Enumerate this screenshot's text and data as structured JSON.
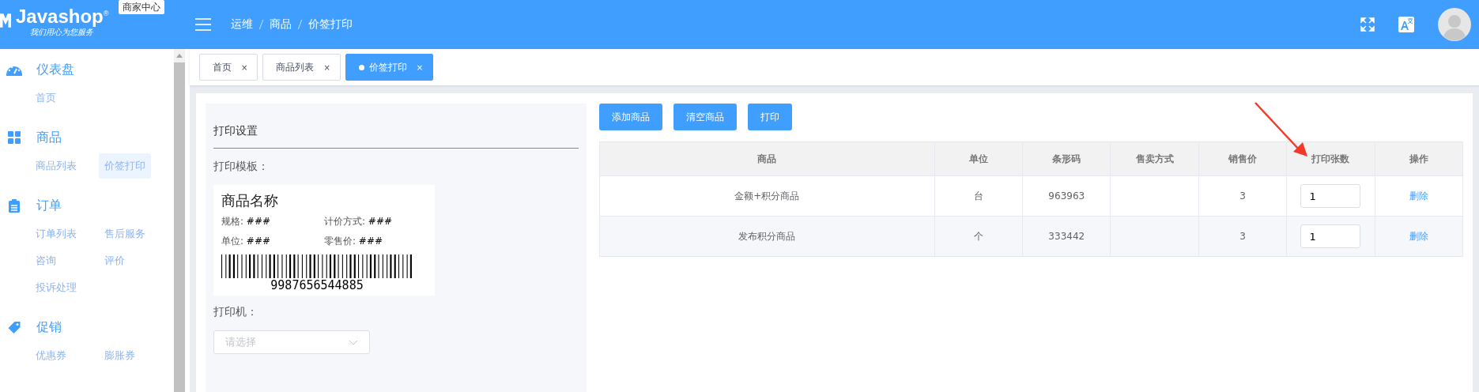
{
  "header": {
    "logo": "Javashop",
    "logo_mark": "®",
    "slogan": "我们用心为您服务",
    "badge": "商家中心",
    "breadcrumb": [
      "运维",
      "商品",
      "价签打印"
    ]
  },
  "sidebar": [
    {
      "title": "仪表盘",
      "items": [
        {
          "label": "首页",
          "selected": false
        }
      ]
    },
    {
      "title": "商品",
      "items": [
        {
          "label": "商品列表",
          "selected": false
        },
        {
          "label": "价签打印",
          "selected": true
        }
      ]
    },
    {
      "title": "订单",
      "items": [
        {
          "label": "订单列表",
          "selected": false
        },
        {
          "label": "售后服务",
          "selected": false
        },
        {
          "label": "咨询",
          "selected": false
        },
        {
          "label": "评价",
          "selected": false
        },
        {
          "label": "投诉处理",
          "selected": false
        }
      ]
    },
    {
      "title": "促销",
      "items": [
        {
          "label": "优惠券",
          "selected": false
        },
        {
          "label": "膨胀券",
          "selected": false
        }
      ]
    }
  ],
  "tabs": [
    {
      "label": "首页",
      "close": "×",
      "selected": false
    },
    {
      "label": "商品列表",
      "close": "×",
      "selected": false
    },
    {
      "label": "价签打印",
      "close": "×",
      "selected": true
    }
  ],
  "settings": {
    "title": "打印设置",
    "template_label": "打印模板：",
    "template": {
      "name": "商品名称",
      "fields": [
        {
          "label": "规格:",
          "value": "###"
        },
        {
          "label": "计价方式:",
          "value": "###"
        },
        {
          "label": "单位:",
          "value": "###"
        },
        {
          "label": "零售价:",
          "value": "###"
        }
      ],
      "barcode": "9987656544885"
    },
    "printer_label": "打印机：",
    "printer_placeholder": "请选择"
  },
  "buttons": [
    "添加商品",
    "清空商品",
    "打印"
  ],
  "table": {
    "columns": [
      "商品",
      "单位",
      "条形码",
      "售卖方式",
      "销售价",
      "打印张数",
      "操作"
    ],
    "rows": [
      {
        "name": "金额+积分商品",
        "unit": "台",
        "barcode": "963963",
        "price": "3",
        "copies": "1",
        "action": "删除"
      },
      {
        "name": "发布积分商品",
        "unit": "个",
        "barcode": "333442",
        "price": "3",
        "copies": "1",
        "action": "删除"
      }
    ]
  }
}
